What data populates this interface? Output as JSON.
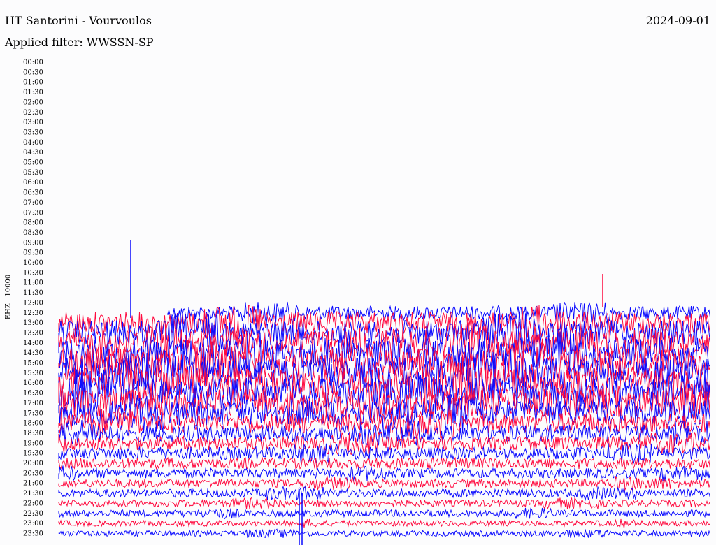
{
  "header": {
    "station": "HT Santorini - Vourvoulos",
    "date": "2024-09-01",
    "filter_label": "Applied filter: WWSSN-SP"
  },
  "chart_data": {
    "type": "line",
    "title": "HT Santorini - Vourvoulos",
    "ylabel": "EHZ - 10000",
    "row_labels": [
      "00:00",
      "00:30",
      "01:00",
      "01:30",
      "02:00",
      "02:30",
      "03:00",
      "03:30",
      "04:00",
      "04:30",
      "05:00",
      "05:30",
      "06:00",
      "06:30",
      "07:00",
      "07:30",
      "08:00",
      "08:30",
      "09:00",
      "09:30",
      "10:00",
      "10:30",
      "11:00",
      "11:30",
      "12:00",
      "12:30",
      "13:00",
      "13:30",
      "14:00",
      "14:30",
      "15:00",
      "15:30",
      "16:00",
      "16:30",
      "17:00",
      "17:30",
      "18:00",
      "18:30",
      "19:00",
      "19:30",
      "20:00",
      "20:30",
      "21:00",
      "21:30",
      "22:00",
      "22:30",
      "23:00",
      "23:30"
    ],
    "trace_colors": [
      "#ff0a3f",
      "#0a0aff"
    ],
    "recording_start": "11:30",
    "noise_amplitude_by_row": [
      0,
      0,
      0,
      0,
      0,
      0,
      0,
      0,
      0,
      0,
      0,
      0,
      0,
      0,
      0,
      0,
      0,
      0,
      0,
      0,
      0,
      0,
      0,
      0,
      0,
      10,
      16,
      18,
      20,
      22,
      22,
      22,
      22,
      22,
      20,
      18,
      14,
      12,
      10,
      9,
      8,
      7,
      6,
      6,
      5,
      5,
      4,
      4
    ],
    "events": [
      {
        "time": "09:00",
        "minute": 4.5,
        "label": "spike"
      },
      {
        "time": "12:00",
        "minute": 10,
        "label": "burst"
      },
      {
        "time": "22:00",
        "minute": 11.5,
        "label": "burst"
      },
      {
        "time": "23:00",
        "minute": 11.5,
        "label": "burst"
      },
      {
        "time": "12:00",
        "minute": 28,
        "label": "burst"
      }
    ]
  }
}
